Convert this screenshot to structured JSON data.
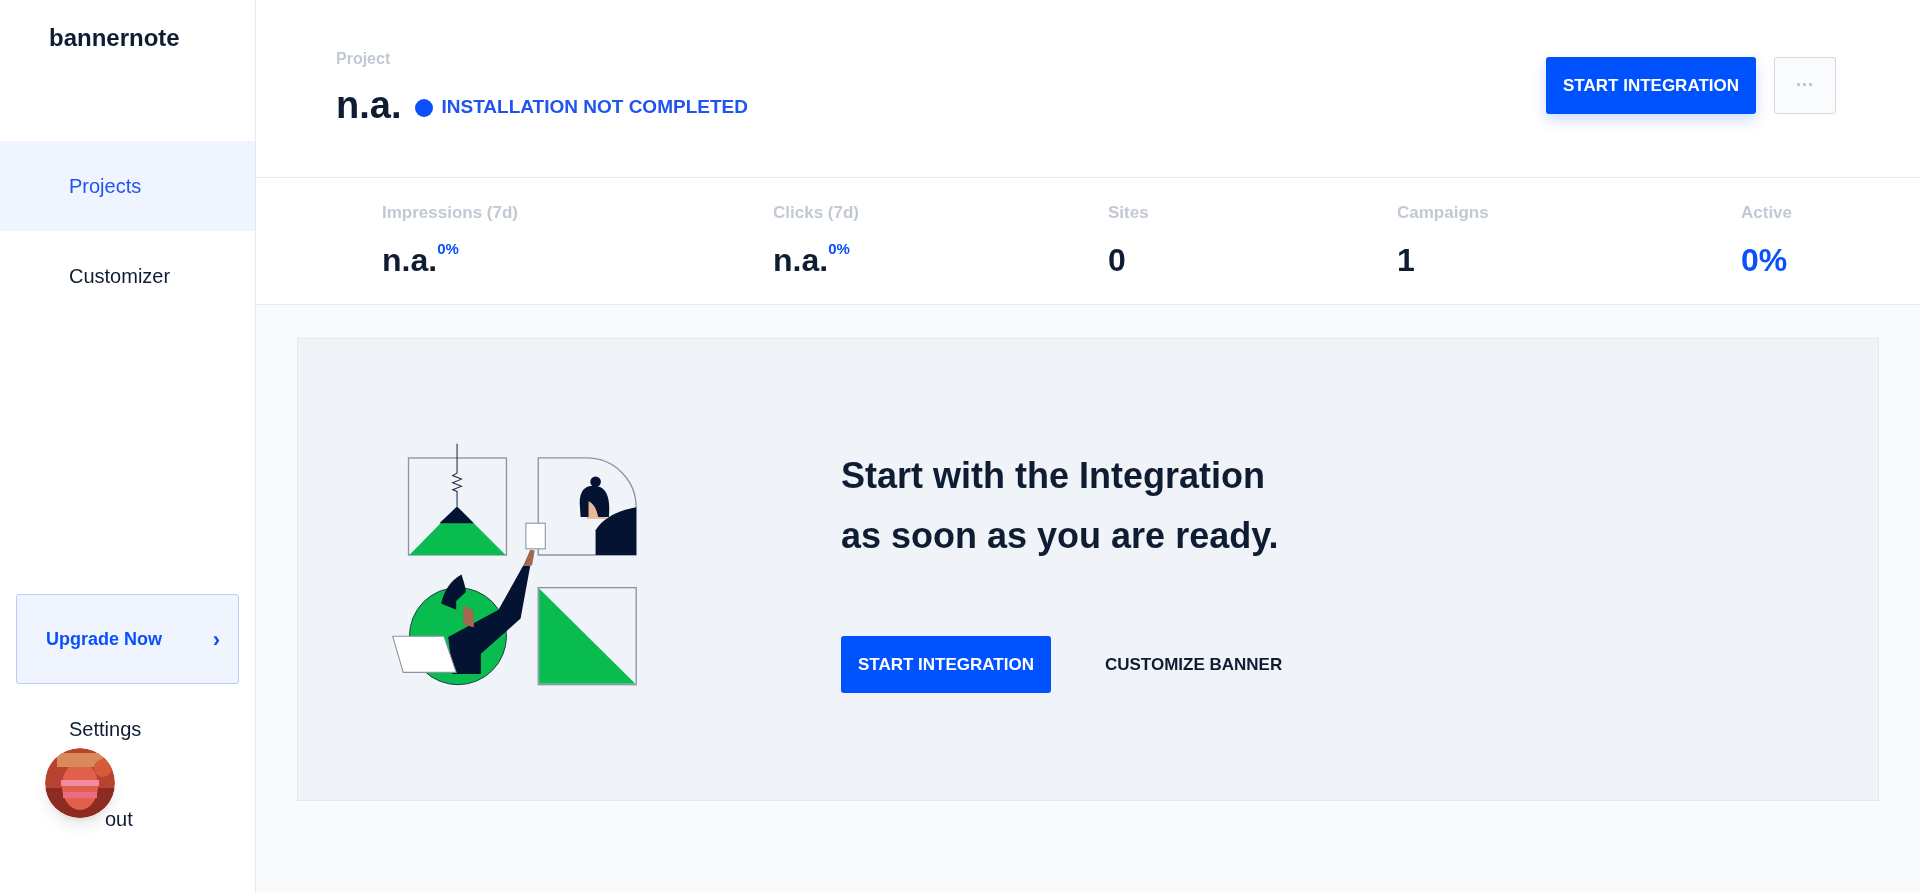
{
  "sidebar": {
    "logo": "bannernote",
    "items": [
      {
        "label": "Projects",
        "selected": true
      },
      {
        "label": "Customizer",
        "selected": false
      }
    ],
    "upgrade": {
      "label": "Upgrade Now",
      "chevron": "›"
    },
    "bottom_items": [
      {
        "label": "Settings"
      },
      {
        "label": "out"
      }
    ]
  },
  "header": {
    "label": "Project",
    "name": "n.a.",
    "status": "INSTALLATION NOT COMPLETED",
    "primary_button": "START INTEGRATION",
    "more_button": "···"
  },
  "stats": [
    {
      "label": "Impressions (7d)",
      "value": "n.a.",
      "change": "0%",
      "kind": "plain"
    },
    {
      "label": "Clicks (7d)",
      "value": "n.a.",
      "change": "0%",
      "kind": "plain"
    },
    {
      "label": "Sites",
      "value": "0",
      "kind": "plain"
    },
    {
      "label": "Campaigns",
      "value": "1",
      "kind": "plain"
    },
    {
      "label": "Active",
      "value": "0%",
      "kind": "accent"
    }
  ],
  "empty_state": {
    "heading_lines": [
      "Start with the Integration",
      "as soon as you are ready."
    ],
    "primary_button": "START INTEGRATION",
    "secondary_button": "CUSTOMIZE BANNER"
  }
}
